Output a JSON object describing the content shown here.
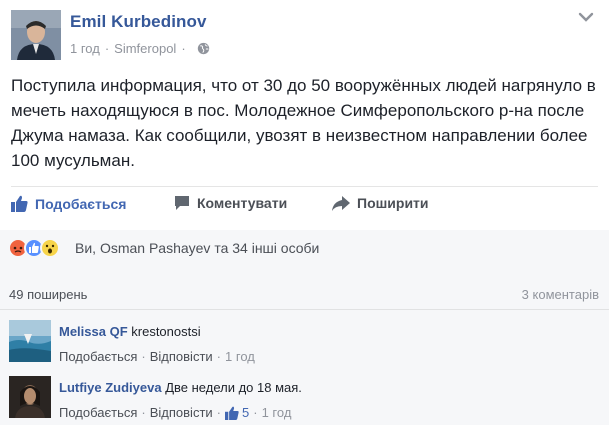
{
  "post": {
    "author": "Emil Kurbedinov",
    "time": "1 год",
    "separator": "·",
    "location": "Simferopol",
    "text": "Поступила информация, что от 30 до 50 вооружённых людей нагрянуло в мечеть находящуюся в пос. Молодежное Симферопольского р-на после Джума намаза. Как сообщили, увозят в неизвестном направлении более 100 мусульман."
  },
  "actions": {
    "like_label": "Подобається",
    "comment_label": "Коментувати",
    "share_label": "Поширити"
  },
  "reactions": {
    "icons": [
      "angry-icon",
      "like-icon",
      "wow-icon"
    ],
    "text": "Ви, Osman Pashayev та 34 інші особи",
    "colors": {
      "angry": "#f0633f",
      "like": "#5890ff",
      "wow": "#f7d44a"
    }
  },
  "stats": {
    "shares": "49 поширень",
    "comments": "3 коментарів"
  },
  "comments": [
    {
      "author": "Melissa QF",
      "text": "krestonostsi",
      "like_label": "Подобається",
      "reply_label": "Відповісти",
      "time": "1 год"
    },
    {
      "author": "Lutfiye Zudiyeva",
      "text": "Две недели до 18 мая.",
      "like_label": "Подобається",
      "reply_label": "Відповісти",
      "likes": "5",
      "time": "1 год"
    }
  ],
  "colors": {
    "link": "#365899",
    "accent": "#4267b2",
    "muted": "#90949c",
    "bar_bg": "#f6f7f9"
  }
}
